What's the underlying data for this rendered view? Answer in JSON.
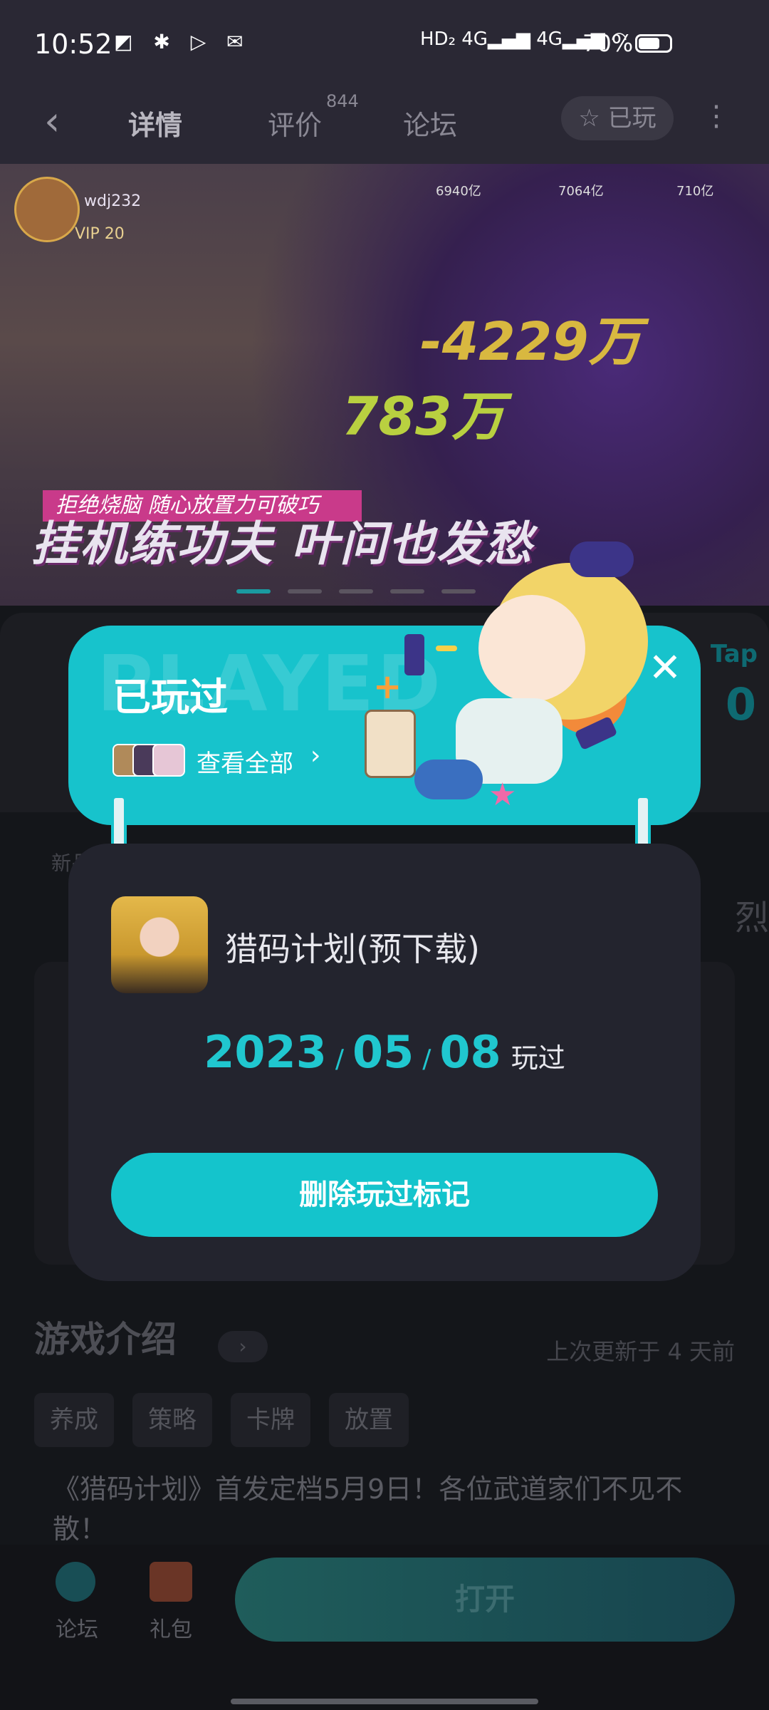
{
  "status_bar": {
    "time": "10:52",
    "battery": "70%",
    "net1": "HD₂",
    "net2": "4G",
    "net3": "4G",
    "battery_level": 0.7
  },
  "header": {
    "tabs": [
      "详情",
      "评价",
      "论坛"
    ],
    "review_count": "844",
    "played_chip": "已玩"
  },
  "banner": {
    "player_name": "wdj232",
    "vip": "VIP 20",
    "res1": "6940亿",
    "res2": "7064亿",
    "res3": "710亿",
    "damage1": "-4229万",
    "damage2": "783万",
    "slogan_top": "拒绝烧脑 随心放置力可破巧",
    "slogan": "挂机练功夫 叶问也发愁"
  },
  "modal": {
    "bg_text": "PLAYED",
    "title": "已玩过",
    "view_all": "查看全部",
    "game_name": "猎码计划(预下载)",
    "date": {
      "year": "2023",
      "month": "05",
      "day": "08",
      "sep": "/",
      "suffix": "玩过"
    },
    "delete_button": "删除玩过标记"
  },
  "underlay": {
    "tap_label": "Tap",
    "tap_value": "0",
    "stub1": "新品",
    "stub2": "烈",
    "section_title": "游戏介绍",
    "updated": "上次更新于 4 天前",
    "tags": [
      "养成",
      "策略",
      "卡牌",
      "放置"
    ],
    "description": "《猎码计划》首发定档5月9日！各位武道家们不见不散！"
  },
  "bottom_bar": {
    "forum": "论坛",
    "gift": "礼包",
    "open": "打开"
  },
  "colors": {
    "accent": "#17c3cc",
    "modal_body": "#23242e",
    "backdrop": "#14161a"
  }
}
